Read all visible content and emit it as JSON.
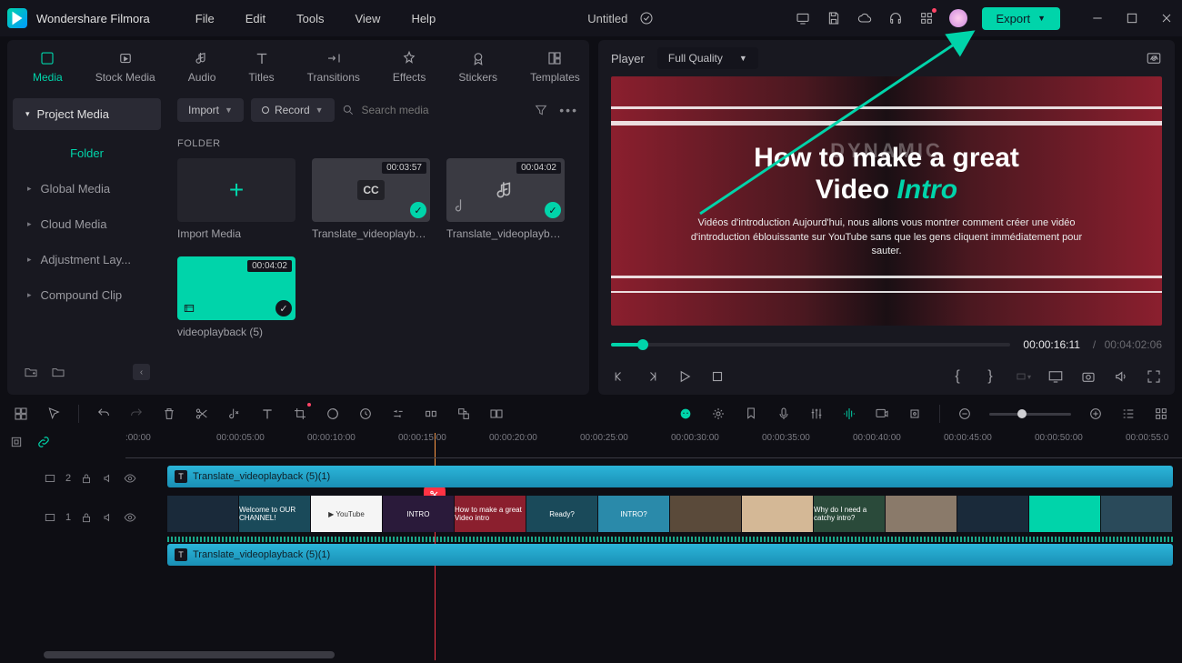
{
  "app": {
    "name": "Wondershare Filmora",
    "document": "Untitled"
  },
  "menu": [
    "File",
    "Edit",
    "Tools",
    "View",
    "Help"
  ],
  "export_label": "Export",
  "tabs": [
    {
      "label": "Media",
      "active": true
    },
    {
      "label": "Stock Media"
    },
    {
      "label": "Audio"
    },
    {
      "label": "Titles"
    },
    {
      "label": "Transitions"
    },
    {
      "label": "Effects"
    },
    {
      "label": "Stickers"
    },
    {
      "label": "Templates"
    }
  ],
  "sidebar": {
    "project_media": "Project Media",
    "folder_label": "Folder",
    "items": [
      "Global Media",
      "Cloud Media",
      "Adjustment Lay...",
      "Compound Clip"
    ]
  },
  "media_toolbar": {
    "import": "Import",
    "record": "Record",
    "search_placeholder": "Search media"
  },
  "folder_header": "FOLDER",
  "thumbs": {
    "import_label": "Import Media",
    "t1_dur": "00:03:57",
    "t1_label": "Translate_videoplayba...",
    "t2_dur": "00:04:02",
    "t2_label": "Translate_videoplayba...",
    "t3_dur": "00:04:02",
    "t3_label": "videoplayback (5)"
  },
  "player": {
    "label": "Player",
    "quality": "Full Quality",
    "title_line1": "How to make a great",
    "title_line2a": "Video ",
    "title_line2b": "Intro",
    "subtitle": "Vidéos d'introduction Aujourd'hui, nous allons vous montrer comment créer une vidéo d'introduction éblouissante sur YouTube sans que les gens cliquent immédiatement pour sauter.",
    "time_current": "00:00:16:11",
    "time_duration": "00:04:02:06"
  },
  "ruler": [
    ":00:00",
    "00:00:05:00",
    "00:00:10:00",
    "00:00:15:00",
    "00:00:20:00",
    "00:00:25:00",
    "00:00:30:00",
    "00:00:35:00",
    "00:00:40:00",
    "00:00:45:00",
    "00:00:50:00",
    "00:00:55:0"
  ],
  "tracks": {
    "t2_name": "2",
    "t2_clip": "Translate_videoplayback (5)(1)",
    "t1_name": "1",
    "segments": [
      "",
      "Welcome to OUR CHANNEL!",
      "▶ YouTube",
      "INTRO",
      "How to make a great Video intro",
      "Ready?",
      "INTRO?",
      "",
      "",
      "Why do I need a catchy intro?",
      "",
      "",
      "",
      ""
    ],
    "t0_clip": "Translate_videoplayback (5)(1)"
  }
}
